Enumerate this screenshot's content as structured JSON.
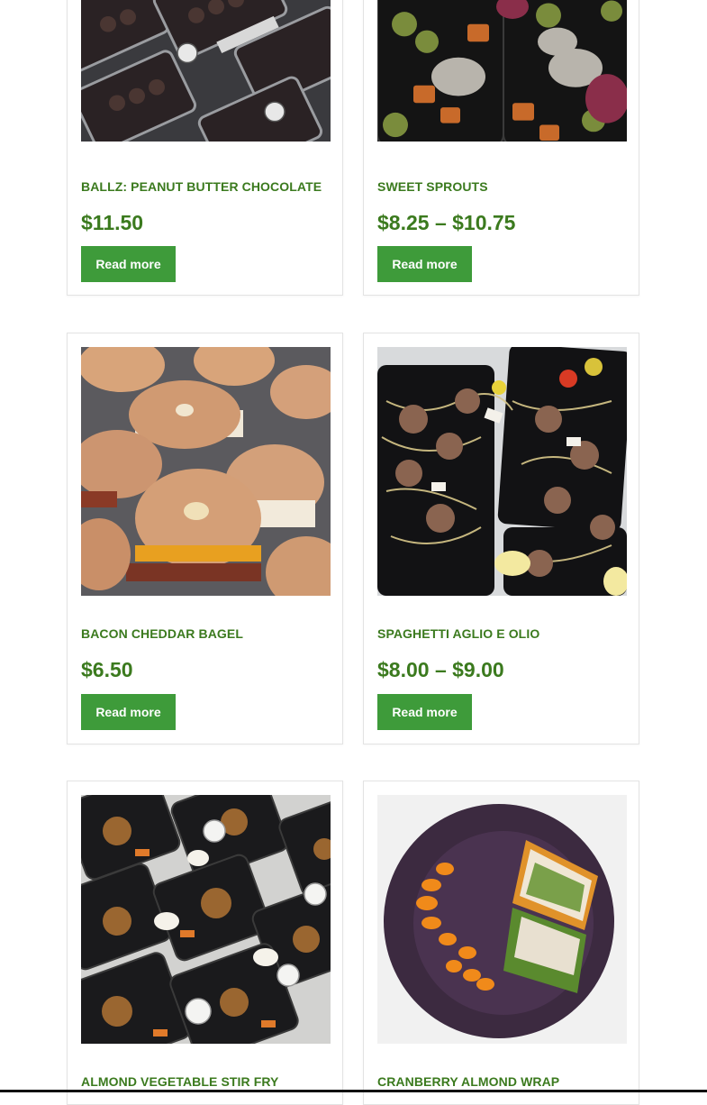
{
  "products": [
    {
      "title": "BALLZ: PEANUT BUTTER CHOCOLATE",
      "price": "$11.50",
      "button": "Read more",
      "image": "peanut-butter-chocolate-balls-photo"
    },
    {
      "title": "SWEET SPROUTS",
      "price": "$8.25 – $10.75",
      "button": "Read more",
      "image": "sweet-sprouts-meal-prep-photo"
    },
    {
      "title": "BACON CHEDDAR BAGEL",
      "price": "$6.50",
      "button": "Read more",
      "image": "bacon-cheddar-bagel-photo"
    },
    {
      "title": "SPAGHETTI AGLIO E OLIO",
      "price": "$8.00 – $9.00",
      "button": "Read more",
      "image": "spaghetti-aglio-e-olio-photo"
    },
    {
      "title": "ALMOND VEGETABLE STIR FRY",
      "price": "",
      "button": "",
      "image": "almond-vegetable-stir-fry-photo"
    },
    {
      "title": "CRANBERRY ALMOND WRAP",
      "price": "",
      "button": "",
      "image": "cranberry-almond-wrap-photo"
    }
  ],
  "colors": {
    "title": "#3b7a1e",
    "button": "#3e9b3a",
    "border": "#e3e3e3"
  }
}
